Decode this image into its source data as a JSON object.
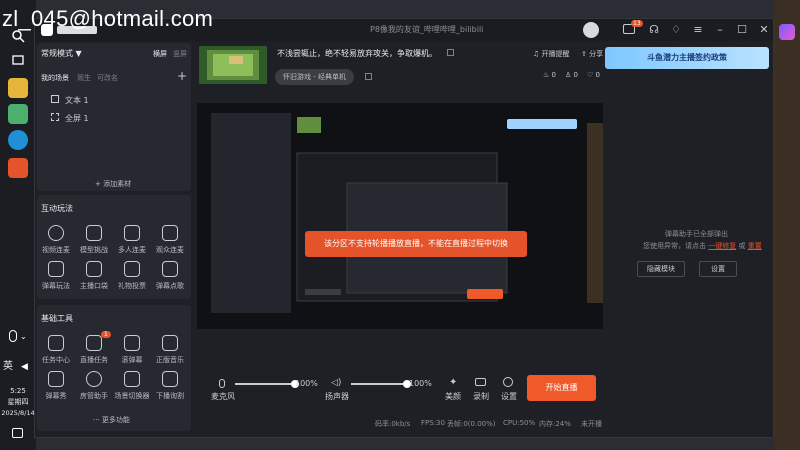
{
  "watermark": "zl_045@hotmail.com",
  "window": {
    "title": "P8像我的友谊_哔哩哔哩_bilibili",
    "notif_count": "13"
  },
  "left": {
    "mode": "常规模式 ▼",
    "mode_tabs": [
      "横屏",
      "竖屏"
    ],
    "scene_tabs": [
      "我的场景",
      "观生",
      "可改名"
    ],
    "add_icon": "+",
    "scenes": [
      "文本 1",
      "全屏 1"
    ],
    "add_material": "+ 添加素材",
    "interactive_title": "互动玩法",
    "interactive": [
      "视频连麦",
      "模型挑战",
      "多人连麦",
      "观众连麦",
      "弹幕玩法",
      "主播口袋",
      "礼物投票",
      "弹幕点歌"
    ],
    "basic_title": "基础工具",
    "basic": [
      "任务中心",
      "直播任务",
      "滚弹幕",
      "正版音乐",
      "弹幕秀",
      "房管助手",
      "场景切换器",
      "下播询割"
    ],
    "basic_badge": "1",
    "more": "更多功能"
  },
  "top": {
    "headline": "不浅尝辄止，绝不轻易放弃攻关，争取爆机。",
    "category": "怀旧游戏 - 经典单机",
    "remind": "开播提醒",
    "share": "分享",
    "stats": [
      "0",
      "0",
      "0"
    ],
    "banner": "斗鱼潜力主播签约政策"
  },
  "preview": {
    "toast": "该分区不支持轮播播放直播，不能在直播过程中切换"
  },
  "bottom": {
    "mic_label": "麦克风",
    "mic_value": "100%",
    "mic_level": 1.0,
    "speaker_label": "扬声器",
    "speaker_value": "100%",
    "speaker_level": 1.0,
    "beauty": "美颜",
    "record": "录制",
    "settings": "设置",
    "start": "开始直播"
  },
  "status": [
    "码率:0kb/s",
    "FPS:30",
    "丢帧:0(0.00%)",
    "CPU:50%",
    "内存:24%",
    "未开播"
  ],
  "right": {
    "notice": "弹幕助手已全部弹出",
    "notice2": "您使用异常，请点击",
    "link1": "一键修复",
    "link_sep": "或",
    "link2": "重置",
    "btn_hide": "隐藏模块",
    "btn_settings": "设置"
  },
  "system": {
    "ime": "英",
    "time": "5:25",
    "weekday": "星期四",
    "date": "2025/8/14"
  },
  "colors": {
    "accent": "#f05a2a",
    "panel": "#262930",
    "window": "#1e2026"
  }
}
